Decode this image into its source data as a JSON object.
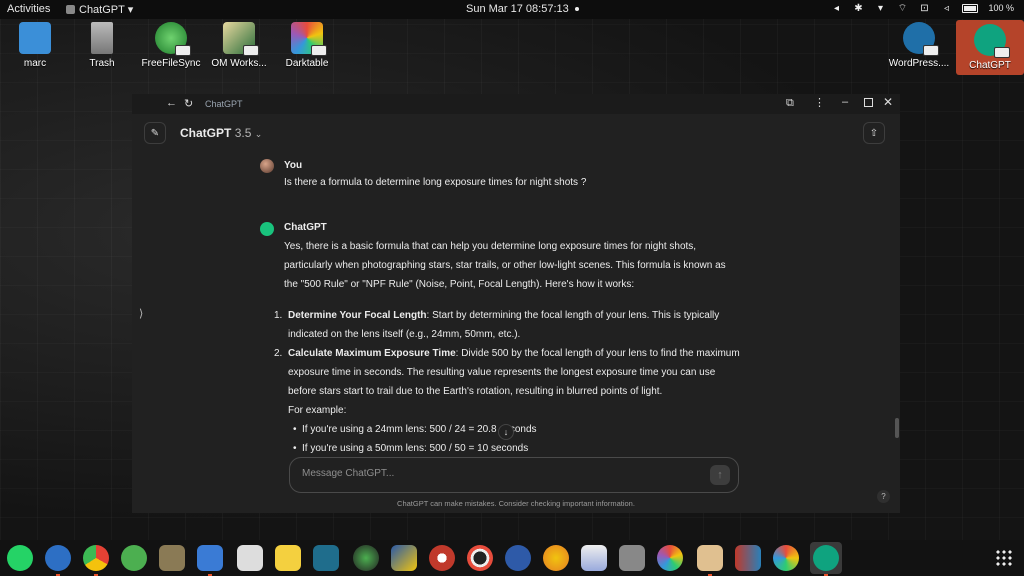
{
  "topbar": {
    "activities": "Activities",
    "app_name": "ChatGPT ▾",
    "clock": "Sun Mar 17  08:57:13",
    "battery": "100 %"
  },
  "desktop": {
    "icons": [
      {
        "label": "marc",
        "icon": "folder-home-icon",
        "color": "#3b8fd8"
      },
      {
        "label": "Trash",
        "icon": "trash-icon",
        "color": "#9a9a9a"
      },
      {
        "label": "FreeFileSync",
        "icon": "sync-icon",
        "color": "#2e9b3c"
      },
      {
        "label": "OM Works...",
        "icon": "om-workspace-icon",
        "color": "#2a6d3a"
      },
      {
        "label": "Darktable",
        "icon": "darktable-icon",
        "color": "#d9392b"
      },
      {
        "label": "WordPress....",
        "icon": "wordpress-icon",
        "color": "#1f6fa8"
      },
      {
        "label": "ChatGPT",
        "icon": "chatgpt-icon",
        "color": "#0fa37f"
      }
    ]
  },
  "window": {
    "title": "ChatGPT",
    "model_name": "ChatGPT",
    "model_version": "3.5",
    "user": {
      "name": "You",
      "message": "Is there a formula to determine long exposure times for night shots ?"
    },
    "assistant": {
      "name": "ChatGPT",
      "intro_lines": [
        "Yes, there is a basic formula that can help you determine long exposure times for night shots,",
        "particularly when photographing stars, star trails, or other low-light scenes. This formula is known as",
        "the \"500 Rule\" or \"NPF Rule\" (Noise, Point, Focal Length). Here's how it works:"
      ],
      "steps": [
        {
          "num": "1.",
          "bold": "Determine Your Focal Length",
          "lines": [
            ": Start by determining the focal length of your lens. This is typically",
            "indicated on the lens itself (e.g., 24mm, 50mm, etc.)."
          ]
        },
        {
          "num": "2.",
          "bold": "Calculate Maximum Exposure Time",
          "lines": [
            ": Divide 500 by the focal length of your lens to find the maximum",
            "exposure time in seconds. The resulting value represents the longest exposure time you can use",
            "before stars start to trail due to the Earth's rotation, resulting in blurred points of light."
          ]
        }
      ],
      "example_label": "For example:",
      "bullets": [
        "If you're using a 24mm lens: 500 / 24 = 20.8 seconds",
        "If you're using a 50mm lens: 500 / 50 = 10 seconds"
      ]
    },
    "input_placeholder": "Message ChatGPT...",
    "disclaimer": "ChatGPT can make mistakes. Consider checking important information.",
    "help": "?"
  },
  "dock": {
    "apps": [
      {
        "name": "whatsapp",
        "color": "#25d366"
      },
      {
        "name": "thunderbird",
        "color": "#2d6fc4"
      },
      {
        "name": "chrome",
        "color": "#e44134"
      },
      {
        "name": "recycle",
        "color": "#4caf50"
      },
      {
        "name": "gimp",
        "color": "#8a7a55"
      },
      {
        "name": "text-editor",
        "color": "#3a7bd5"
      },
      {
        "name": "inkscape",
        "color": "#ddd"
      },
      {
        "name": "sticky-notes",
        "color": "#f4d03f"
      },
      {
        "name": "book",
        "color": "#1f6d8c"
      },
      {
        "name": "image-viewer",
        "color": "#333"
      },
      {
        "name": "dvd",
        "color": "#2a5aa8"
      },
      {
        "name": "compass",
        "color": "#c0392b"
      },
      {
        "name": "camera",
        "color": "#555"
      },
      {
        "name": "cheese",
        "color": "#c0392b"
      },
      {
        "name": "picasa",
        "color": "#e67e22"
      },
      {
        "name": "shotwell",
        "color": "#ccc"
      },
      {
        "name": "gthumb",
        "color": "#888"
      },
      {
        "name": "colors",
        "color": "#9b59b6"
      },
      {
        "name": "photos",
        "color": "#e0c090"
      },
      {
        "name": "office",
        "color": "#c0392b"
      },
      {
        "name": "pinwheel",
        "color": "#f1c40f"
      },
      {
        "name": "chatgpt",
        "color": "#0fa37f"
      }
    ]
  }
}
